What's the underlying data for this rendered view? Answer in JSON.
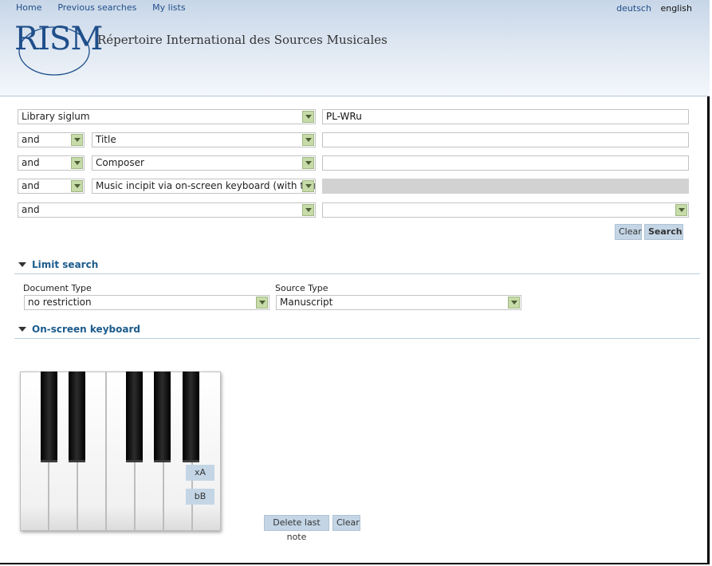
{
  "nav": {
    "home": "Home",
    "previous_searches": "Previous searches",
    "my_lists": "My lists",
    "lang_de": "deutsch",
    "lang_en": "english"
  },
  "header": {
    "logo_text": "RISM",
    "site_title": "Répertoire International des Sources Musicales"
  },
  "search": {
    "rows": [
      {
        "field": "Library siglum",
        "value": "PL-WRu"
      },
      {
        "op": "and",
        "field": "Title",
        "value": ""
      },
      {
        "op": "and",
        "field": "Composer",
        "value": ""
      },
      {
        "op": "and",
        "field": "Music incipit via on-screen keyboard (with trans",
        "value": ""
      },
      {
        "op": "and",
        "value": ""
      }
    ],
    "clear_label": "Clear",
    "search_label": "Search"
  },
  "limit": {
    "title": "Limit search",
    "document_type_label": "Document Type",
    "document_type_value": "no restriction",
    "source_type_label": "Source Type",
    "source_type_value": "Manuscript"
  },
  "keyboard": {
    "title": "On-screen keyboard",
    "label_xa": "xA",
    "label_bb": "bB",
    "delete_last_label": "Delete last note",
    "clear_label": "Clear"
  },
  "colors": {
    "accent": "#1b5b8c",
    "button_bg": "#c4d6e6",
    "select_arrow_bg": "#c7dba8"
  }
}
